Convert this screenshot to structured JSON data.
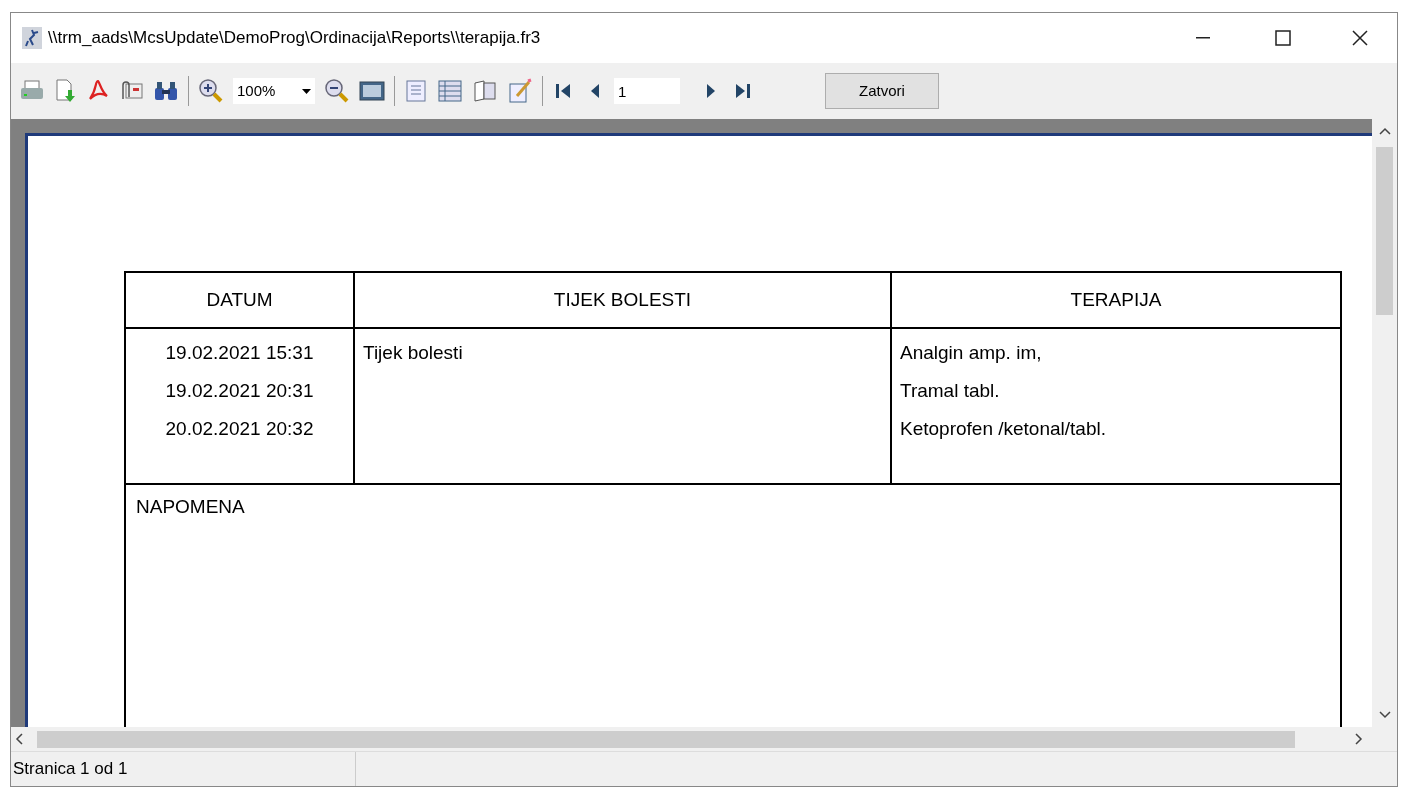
{
  "window": {
    "title": "\\\\trm_aads\\McsUpdate\\DemoProg\\Ordinacija\\Reports\\\\terapija.fr3"
  },
  "toolbar": {
    "zoom": "100%",
    "page": "1",
    "close_button": "Zatvori"
  },
  "report": {
    "columns": [
      "DATUM",
      "TIJEK BOLESTI",
      "TERAPIJA"
    ],
    "dates": [
      "19.02.2021 15:31",
      "19.02.2021 20:31",
      "20.02.2021 20:32"
    ],
    "course": [
      "Tijek bolesti"
    ],
    "therapy": [
      "Analgin amp. im,",
      "Tramal tabl.",
      "Ketoprofen /ketonal/tabl."
    ],
    "note_label": "NAPOMENA"
  },
  "status_bar": {
    "page": "Stranica 1 od 1"
  }
}
